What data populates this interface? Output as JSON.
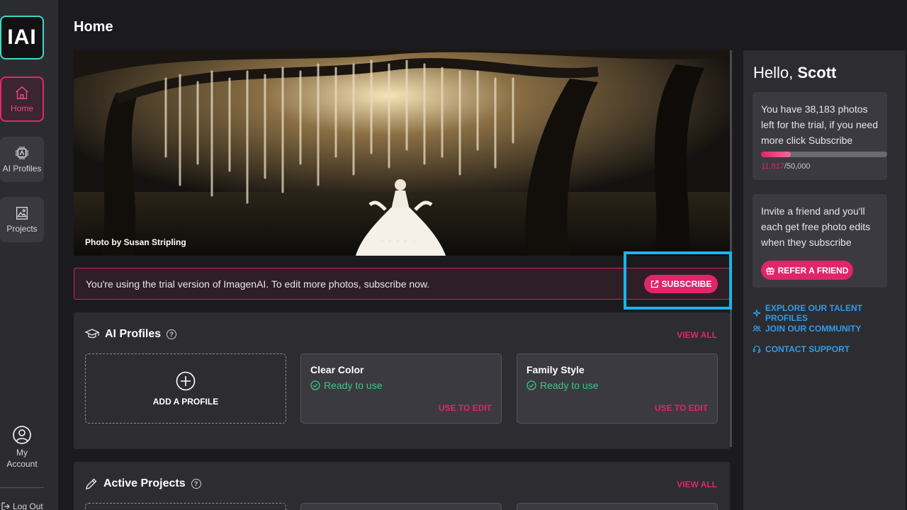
{
  "app": {
    "logo": "IAI"
  },
  "sidebar": {
    "items": [
      {
        "label": "Home",
        "icon": "home-icon",
        "active": true
      },
      {
        "label": "AI Profiles",
        "icon": "chip-icon",
        "active": false
      },
      {
        "label": "Projects",
        "icon": "image-icon",
        "active": false
      }
    ],
    "account_label": "My Account",
    "logout_label": "Log Out"
  },
  "header": {
    "title": "Home"
  },
  "hero": {
    "credit": "Photo by Susan Stripling",
    "slides": 5,
    "active_slide": 5
  },
  "trial_banner": {
    "text": "You're using the trial version of ImagenAI. To edit more photos, subscribe now.",
    "button_label": "SUBSCRIBE"
  },
  "ai_profiles": {
    "title": "AI Profiles",
    "view_all": "VIEW ALL",
    "add_label": "ADD A PROFILE",
    "profiles": [
      {
        "name": "Clear Color",
        "status": "Ready to use",
        "action": "USE TO EDIT"
      },
      {
        "name": "Family Style",
        "status": "Ready to use",
        "action": "USE TO EDIT"
      }
    ]
  },
  "active_projects": {
    "title": "Active Projects",
    "view_all": "VIEW ALL"
  },
  "right_panel": {
    "greeting": "Hello, ",
    "user_name": "Scott",
    "trial_card": {
      "text": "You have 38,183 photos left for the trial, if you need more click Subscribe",
      "used": "11,817",
      "total": "/50,000",
      "used_fraction": 0.2363
    },
    "invite_card": {
      "text": "Invite a friend and you'll each get free photo edits when they subscribe",
      "button_label": "REFER A FRIEND"
    },
    "links": [
      {
        "label": "EXPLORE OUR TALENT PROFILES",
        "icon": "sparkle-icon"
      },
      {
        "label": "JOIN OUR COMMUNITY",
        "icon": "people-icon"
      },
      {
        "label": "CONTACT SUPPORT",
        "icon": "headset-icon"
      }
    ]
  },
  "colors": {
    "accent": "#e0256a",
    "link": "#2f9de8",
    "ready": "#3cc785",
    "logo_border": "#3fd8c8",
    "highlight": "#18b6ea"
  }
}
